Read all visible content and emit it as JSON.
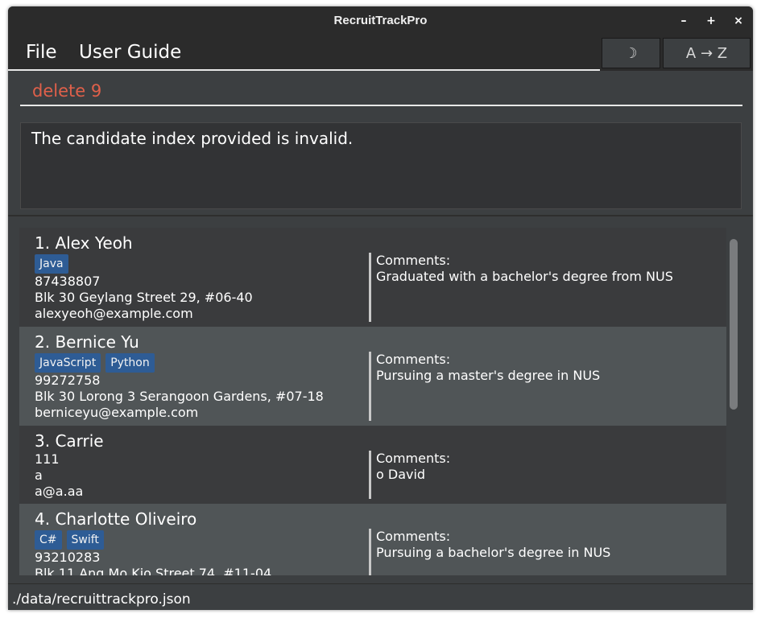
{
  "window": {
    "title": "RecruitTrackPro",
    "controls": {
      "minimize": "–",
      "maximize": "+",
      "close": "×"
    }
  },
  "menu": {
    "file": "File",
    "user_guide": "User Guide"
  },
  "toolbar": {
    "theme_toggle": "☽",
    "sort": "A → Z"
  },
  "command": {
    "value": "delete 9"
  },
  "result": {
    "message": "The candidate index provided is invalid."
  },
  "candidates": [
    {
      "name": "1. Alex Yeoh",
      "tags": [
        "Java"
      ],
      "phone": "87438807",
      "address": "Blk 30 Geylang Street 29, #06-40",
      "email": "alexyeoh@example.com",
      "comments_label": "Comments:",
      "comment": "Graduated with a bachelor's degree from NUS"
    },
    {
      "name": "2. Bernice Yu",
      "tags": [
        "JavaScript",
        "Python"
      ],
      "phone": "99272758",
      "address": "Blk 30 Lorong 3 Serangoon Gardens, #07-18",
      "email": "berniceyu@example.com",
      "comments_label": "Comments:",
      "comment": "Pursuing a master's degree in NUS"
    },
    {
      "name": "3. Carrie",
      "tags": [],
      "phone": "111",
      "address": "a",
      "email": "a@a.aa",
      "comments_label": "Comments:",
      "comment": "o David"
    },
    {
      "name": "4. Charlotte Oliveiro",
      "tags": [
        "C#",
        "Swift"
      ],
      "phone": "93210283",
      "address": "Blk 11 Ang Mo Kio Street 74, #11-04",
      "email": "",
      "comments_label": "Comments:",
      "comment": "Pursuing a bachelor's degree in NUS"
    }
  ],
  "status": {
    "file_path": "./data/recruittrackpro.json"
  },
  "colors": {
    "background": "#3c3f41",
    "titlebar": "#2b2b2b",
    "tag": "#2e5c95",
    "command_text": "#e0604a",
    "card_alt": "#505557"
  }
}
